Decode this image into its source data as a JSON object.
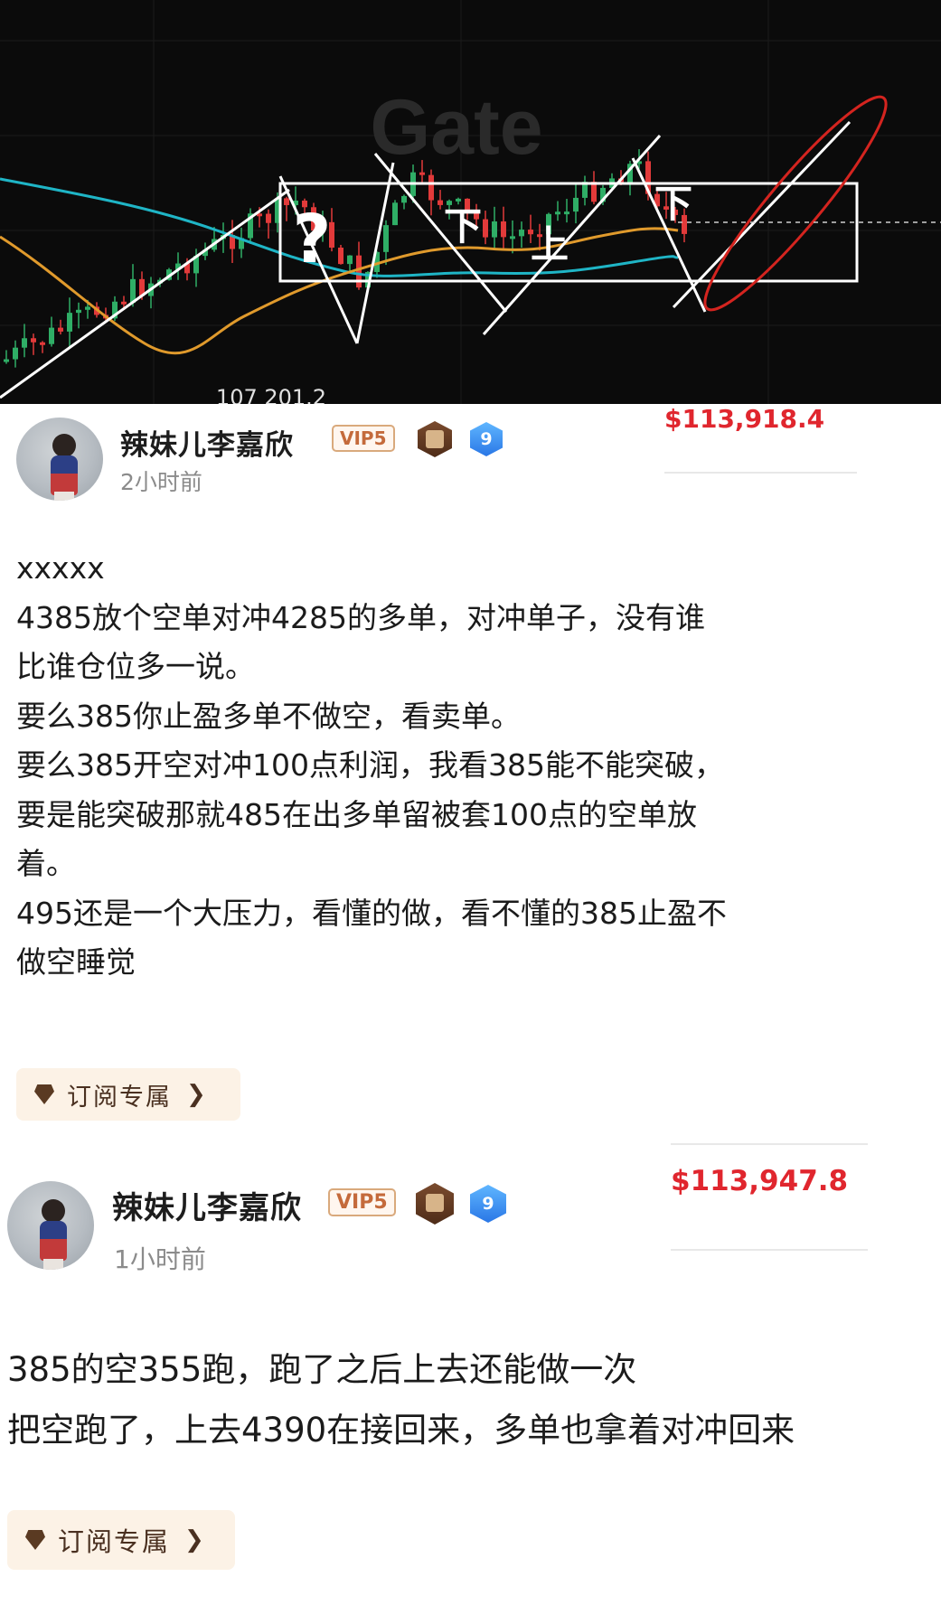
{
  "chart": {
    "watermark": "Gate",
    "annotation_q": "?",
    "annotation_down1": "下",
    "annotation_up": "上",
    "annotation_down2": "下",
    "bottom_label": "107 201.2",
    "colors": {
      "up": "#2fae66",
      "down": "#e23a3a",
      "ma_teal": "#1fb5c6",
      "ma_orange": "#e09a2c",
      "annot": "#ffffff",
      "circle": "#d4241f"
    }
  },
  "posts": [
    {
      "author": "辣妹儿李嘉欣",
      "vip": "VIP5",
      "level": "9",
      "time": "2小时前",
      "price": "$113,918.4",
      "lines": [
        "xxxxx",
        "4385放个空单对冲4285的多单，对冲单子，没有谁",
        "比谁仓位多一说。",
        "要么385你止盈多单不做空，看卖单。",
        "要么385开空对冲100点利润，我看385能不能突破，",
        "要是能突破那就485在出多单留被套100点的空单放",
        "着。",
        "495还是一个大压力，看懂的做，看不懂的385止盈不",
        "做空睡觉"
      ],
      "subscribe": "订阅专属"
    },
    {
      "author": "辣妹儿李嘉欣",
      "vip": "VIP5",
      "level": "9",
      "time": "1小时前",
      "price": "$113,947.8",
      "lines": [
        "385的空355跑，跑了之后上去还能做一次",
        "把空跑了，上去4390在接回来，多单也拿着对冲回来"
      ],
      "subscribe": "订阅专属"
    }
  ]
}
